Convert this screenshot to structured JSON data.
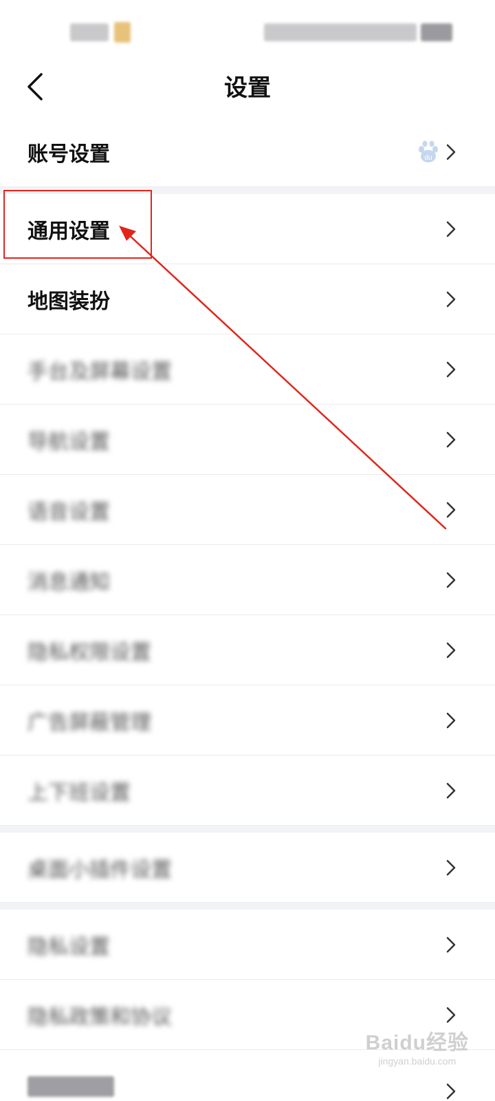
{
  "header": {
    "title": "设置"
  },
  "rows": [
    {
      "label": "账号设置"
    },
    {
      "label": "通用设置"
    },
    {
      "label": "地图装扮"
    },
    {
      "label": "手台及屏幕设置"
    },
    {
      "label": "导航设置"
    },
    {
      "label": "语音设置"
    },
    {
      "label": "消息通知"
    },
    {
      "label": "隐私权限设置"
    },
    {
      "label": "广告屏蔽管理"
    },
    {
      "label": "上下班设置"
    },
    {
      "label": "桌面小插件设置"
    },
    {
      "label": "隐私设置"
    },
    {
      "label": "隐私政策和协议"
    }
  ],
  "icons": {
    "back": "chevron-left-icon",
    "chevron": "chevron-right-icon",
    "account_badge": "baidu-paw-icon"
  },
  "annotation": {
    "color": "#e1251b"
  },
  "watermark": {
    "logo": "Baidu经验",
    "url": "jingyan.baidu.com"
  }
}
